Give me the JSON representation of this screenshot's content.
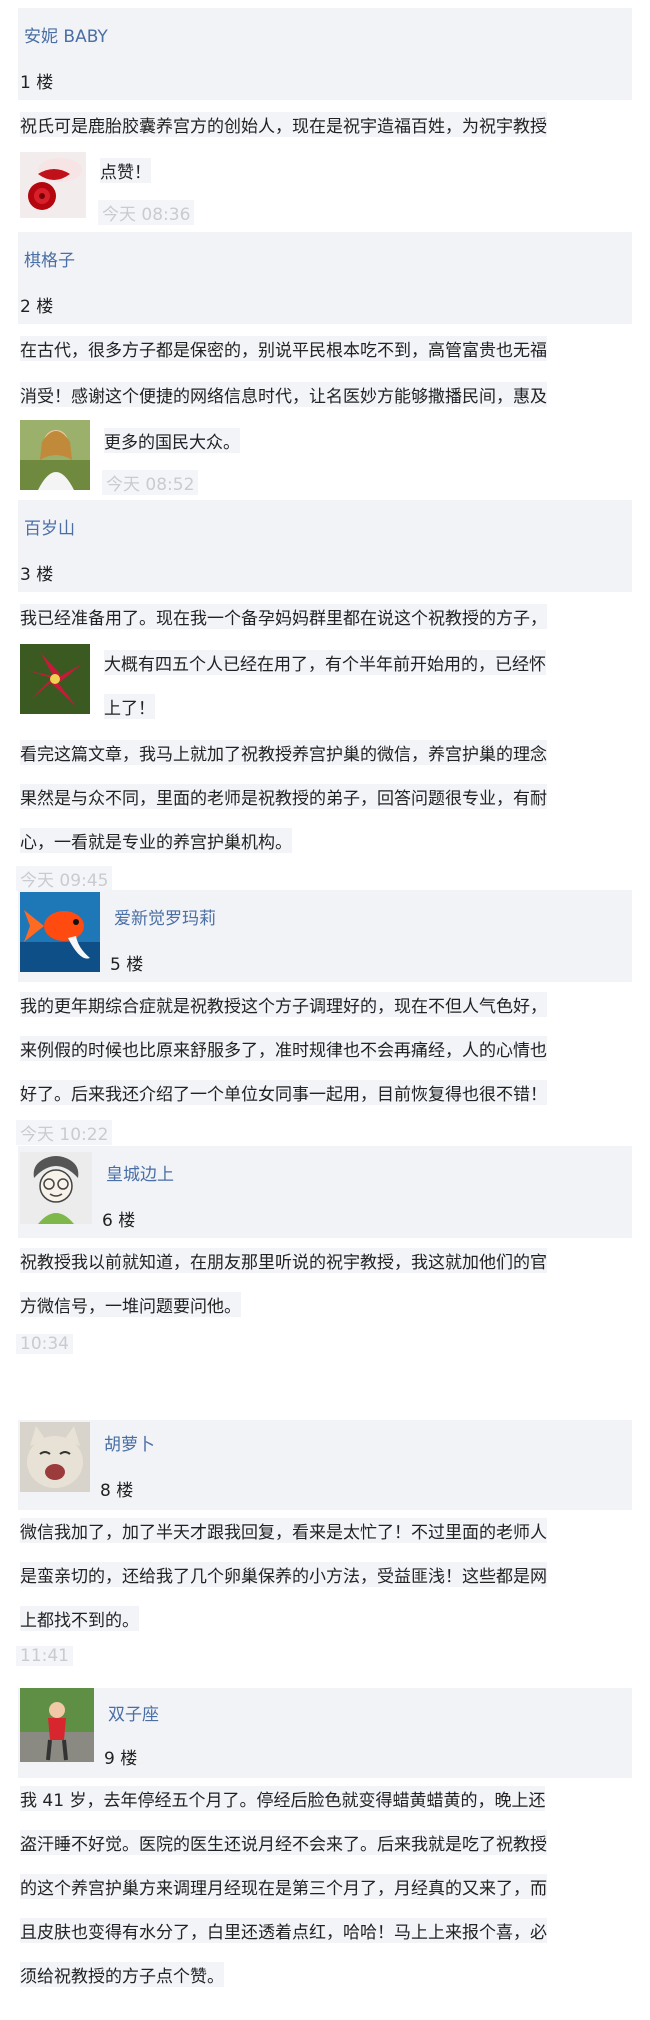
{
  "comments": [
    {
      "nick": "安妮 BABY",
      "floor": "1 楼",
      "lines": [
        "祝氏可是鹿胎胶囊养宫方的创始人，现在是祝宇造福百姓，为祝宇教授",
        "点赞！"
      ],
      "time": "今天 08:36",
      "avatar": "lips-rose-avatar"
    },
    {
      "nick": "棋格子",
      "floor": "2 楼",
      "lines": [
        "在古代，很多方子都是保密的，别说平民根本吃不到，高管富贵也无福",
        "消受！感谢这个便捷的网络信息时代，让名医妙方能够撒播民间，惠及",
        "更多的国民大众。"
      ],
      "time": "今天 08:52",
      "avatar": "woman-portrait-avatar"
    },
    {
      "nick": "百岁山",
      "floor": "3 楼",
      "lines": [
        "我已经准备用了。现在我一个备孕妈妈群里都在说这个祝教授的方子，",
        "大概有四五个人已经在用了，有个半年前开始用的，已经怀",
        "上了！",
        "看完这篇文章，我马上就加了祝教授养宫护巢的微信，养宫护巢的理念",
        "果然是与众不同，里面的老师是祝教授的弟子，回答问题很专业，有耐",
        "心，一看就是专业的养宫护巢机构。"
      ],
      "time": "今天 09:45",
      "avatar": "lily-flower-avatar"
    },
    {
      "nick": "爱新觉罗玛莉",
      "floor": "5 楼",
      "lines": [
        "我的更年期综合症就是祝教授这个方子调理好的，现在不但人气色好，",
        "来例假的时候也比原来舒服多了，准时规律也不会再痛经，人的心情也",
        "好了。后来我还介绍了一个单位女同事一起用，目前恢复得也很不错！"
      ],
      "time": "今天 10:22",
      "avatar": "goldfish-avatar"
    },
    {
      "nick": "皇城边上",
      "floor": "6 楼",
      "lines": [
        "祝教授我以前就知道，在朋友那里听说的祝宇教授，我这就加他们的官",
        "方微信号，一堆问题要问他。"
      ],
      "time": "10:34",
      "avatar": "sketch-boy-avatar"
    },
    {
      "nick": "胡萝卜",
      "floor": "8 楼",
      "lines": [
        "微信我加了，加了半天才跟我回复，看来是太忙了！不过里面的老师人",
        "是蛮亲切的，还给我了几个卵巢保养的小方法，受益匪浅！这些都是网",
        "上都找不到的。"
      ],
      "time": "11:41",
      "avatar": "laughing-cat-avatar"
    },
    {
      "nick": "双子座",
      "floor": "9 楼",
      "lines": [
        "我 41 岁，去年停经五个月了。停经后脸色就变得蜡黄蜡黄的，晚上还",
        "盗汗睡不好觉。医院的医生还说月经不会来了。后来我就是吃了祝教授",
        "的这个养宫护巢方来调理月经现在是第三个月了，月经真的又来了，而",
        "且皮肤也变得有水分了，白里还透着点红，哈哈！马上上来报个喜，必",
        "须给祝教授的方子点个赞。"
      ],
      "avatar": "outdoor-girl-avatar"
    }
  ]
}
